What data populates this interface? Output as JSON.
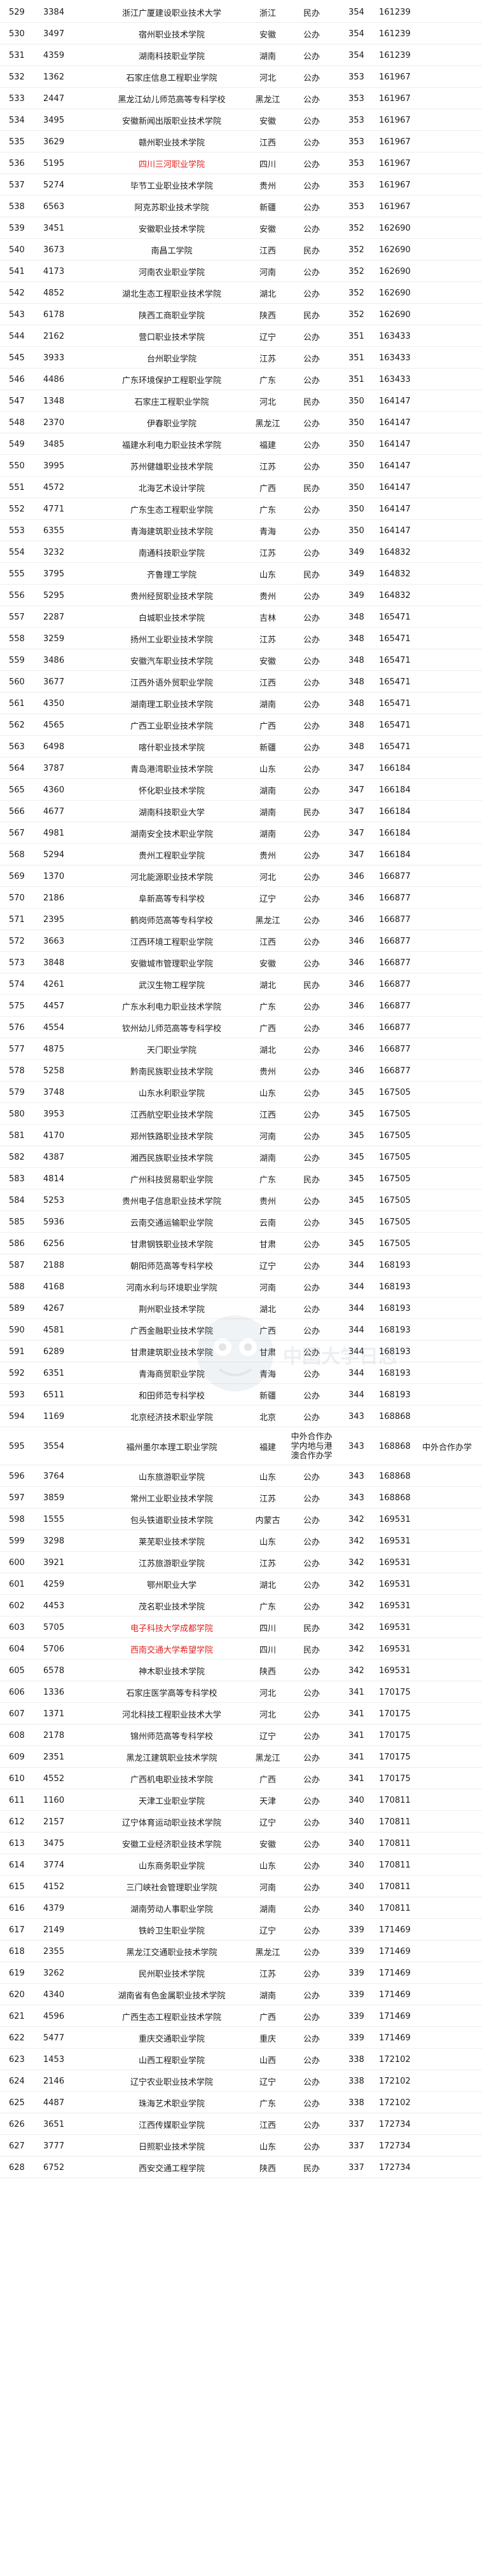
{
  "highlight_color": "#e0221f",
  "watermark": {
    "icon": "cartoon-mascot-face-icon",
    "text": "中国大学日志"
  },
  "rows": [
    {
      "rank": "529",
      "code": "3384",
      "name": "浙江广厦建设职业技术大学",
      "prov": "浙江",
      "type": "民办",
      "score": "354",
      "pos": "161239",
      "note": ""
    },
    {
      "rank": "530",
      "code": "3497",
      "name": "宿州职业技术学院",
      "prov": "安徽",
      "type": "公办",
      "score": "354",
      "pos": "161239",
      "note": ""
    },
    {
      "rank": "531",
      "code": "4359",
      "name": "湖南科技职业学院",
      "prov": "湖南",
      "type": "公办",
      "score": "354",
      "pos": "161239",
      "note": ""
    },
    {
      "rank": "532",
      "code": "1362",
      "name": "石家庄信息工程职业学院",
      "prov": "河北",
      "type": "公办",
      "score": "353",
      "pos": "161967",
      "note": ""
    },
    {
      "rank": "533",
      "code": "2447",
      "name": "黑龙江幼儿师范高等专科学校",
      "prov": "黑龙江",
      "type": "公办",
      "score": "353",
      "pos": "161967",
      "note": ""
    },
    {
      "rank": "534",
      "code": "3495",
      "name": "安徽新闻出版职业技术学院",
      "prov": "安徽",
      "type": "公办",
      "score": "353",
      "pos": "161967",
      "note": ""
    },
    {
      "rank": "535",
      "code": "3629",
      "name": "赣州职业技术学院",
      "prov": "江西",
      "type": "公办",
      "score": "353",
      "pos": "161967",
      "note": ""
    },
    {
      "rank": "536",
      "code": "5195",
      "name": "四川三河职业学院",
      "prov": "四川",
      "type": "公办",
      "score": "353",
      "pos": "161967",
      "note": "",
      "hl": true
    },
    {
      "rank": "537",
      "code": "5274",
      "name": "毕节工业职业技术学院",
      "prov": "贵州",
      "type": "公办",
      "score": "353",
      "pos": "161967",
      "note": ""
    },
    {
      "rank": "538",
      "code": "6563",
      "name": "阿克苏职业技术学院",
      "prov": "新疆",
      "type": "公办",
      "score": "353",
      "pos": "161967",
      "note": ""
    },
    {
      "rank": "539",
      "code": "3451",
      "name": "安徽职业技术学院",
      "prov": "安徽",
      "type": "公办",
      "score": "352",
      "pos": "162690",
      "note": ""
    },
    {
      "rank": "540",
      "code": "3673",
      "name": "南昌工学院",
      "prov": "江西",
      "type": "民办",
      "score": "352",
      "pos": "162690",
      "note": ""
    },
    {
      "rank": "541",
      "code": "4173",
      "name": "河南农业职业学院",
      "prov": "河南",
      "type": "公办",
      "score": "352",
      "pos": "162690",
      "note": ""
    },
    {
      "rank": "542",
      "code": "4852",
      "name": "湖北生态工程职业技术学院",
      "prov": "湖北",
      "type": "公办",
      "score": "352",
      "pos": "162690",
      "note": ""
    },
    {
      "rank": "543",
      "code": "6178",
      "name": "陕西工商职业学院",
      "prov": "陕西",
      "type": "民办",
      "score": "352",
      "pos": "162690",
      "note": ""
    },
    {
      "rank": "544",
      "code": "2162",
      "name": "营口职业技术学院",
      "prov": "辽宁",
      "type": "公办",
      "score": "351",
      "pos": "163433",
      "note": ""
    },
    {
      "rank": "545",
      "code": "3933",
      "name": "台州职业学院",
      "prov": "江苏",
      "type": "公办",
      "score": "351",
      "pos": "163433",
      "note": ""
    },
    {
      "rank": "546",
      "code": "4486",
      "name": "广东环境保护工程职业学院",
      "prov": "广东",
      "type": "公办",
      "score": "351",
      "pos": "163433",
      "note": ""
    },
    {
      "rank": "547",
      "code": "1348",
      "name": "石家庄工程职业学院",
      "prov": "河北",
      "type": "民办",
      "score": "350",
      "pos": "164147",
      "note": ""
    },
    {
      "rank": "548",
      "code": "2370",
      "name": "伊春职业学院",
      "prov": "黑龙江",
      "type": "公办",
      "score": "350",
      "pos": "164147",
      "note": ""
    },
    {
      "rank": "549",
      "code": "3485",
      "name": "福建水利电力职业技术学院",
      "prov": "福建",
      "type": "公办",
      "score": "350",
      "pos": "164147",
      "note": ""
    },
    {
      "rank": "550",
      "code": "3995",
      "name": "苏州健雄职业技术学院",
      "prov": "江苏",
      "type": "公办",
      "score": "350",
      "pos": "164147",
      "note": ""
    },
    {
      "rank": "551",
      "code": "4572",
      "name": "北海艺术设计学院",
      "prov": "广西",
      "type": "民办",
      "score": "350",
      "pos": "164147",
      "note": ""
    },
    {
      "rank": "552",
      "code": "4771",
      "name": "广东生态工程职业学院",
      "prov": "广东",
      "type": "公办",
      "score": "350",
      "pos": "164147",
      "note": ""
    },
    {
      "rank": "553",
      "code": "6355",
      "name": "青海建筑职业技术学院",
      "prov": "青海",
      "type": "公办",
      "score": "350",
      "pos": "164147",
      "note": ""
    },
    {
      "rank": "554",
      "code": "3232",
      "name": "南通科技职业学院",
      "prov": "江苏",
      "type": "公办",
      "score": "349",
      "pos": "164832",
      "note": ""
    },
    {
      "rank": "555",
      "code": "3795",
      "name": "齐鲁理工学院",
      "prov": "山东",
      "type": "民办",
      "score": "349",
      "pos": "164832",
      "note": ""
    },
    {
      "rank": "556",
      "code": "5295",
      "name": "贵州经贸职业技术学院",
      "prov": "贵州",
      "type": "公办",
      "score": "349",
      "pos": "164832",
      "note": ""
    },
    {
      "rank": "557",
      "code": "2287",
      "name": "白城职业技术学院",
      "prov": "吉林",
      "type": "公办",
      "score": "348",
      "pos": "165471",
      "note": ""
    },
    {
      "rank": "558",
      "code": "3259",
      "name": "扬州工业职业技术学院",
      "prov": "江苏",
      "type": "公办",
      "score": "348",
      "pos": "165471",
      "note": ""
    },
    {
      "rank": "559",
      "code": "3486",
      "name": "安徽汽车职业技术学院",
      "prov": "安徽",
      "type": "公办",
      "score": "348",
      "pos": "165471",
      "note": ""
    },
    {
      "rank": "560",
      "code": "3677",
      "name": "江西外语外贸职业学院",
      "prov": "江西",
      "type": "公办",
      "score": "348",
      "pos": "165471",
      "note": ""
    },
    {
      "rank": "561",
      "code": "4350",
      "name": "湖南理工职业技术学院",
      "prov": "湖南",
      "type": "公办",
      "score": "348",
      "pos": "165471",
      "note": ""
    },
    {
      "rank": "562",
      "code": "4565",
      "name": "广西工业职业技术学院",
      "prov": "广西",
      "type": "公办",
      "score": "348",
      "pos": "165471",
      "note": ""
    },
    {
      "rank": "563",
      "code": "6498",
      "name": "喀什职业技术学院",
      "prov": "新疆",
      "type": "公办",
      "score": "348",
      "pos": "165471",
      "note": ""
    },
    {
      "rank": "564",
      "code": "3787",
      "name": "青岛港湾职业技术学院",
      "prov": "山东",
      "type": "公办",
      "score": "347",
      "pos": "166184",
      "note": ""
    },
    {
      "rank": "565",
      "code": "4360",
      "name": "怀化职业技术学院",
      "prov": "湖南",
      "type": "公办",
      "score": "347",
      "pos": "166184",
      "note": ""
    },
    {
      "rank": "566",
      "code": "4677",
      "name": "湖南科技职业大学",
      "prov": "湖南",
      "type": "民办",
      "score": "347",
      "pos": "166184",
      "note": ""
    },
    {
      "rank": "567",
      "code": "4981",
      "name": "湖南安全技术职业学院",
      "prov": "湖南",
      "type": "公办",
      "score": "347",
      "pos": "166184",
      "note": ""
    },
    {
      "rank": "568",
      "code": "5294",
      "name": "贵州工程职业学院",
      "prov": "贵州",
      "type": "公办",
      "score": "347",
      "pos": "166184",
      "note": ""
    },
    {
      "rank": "569",
      "code": "1370",
      "name": "河北能源职业技术学院",
      "prov": "河北",
      "type": "公办",
      "score": "346",
      "pos": "166877",
      "note": ""
    },
    {
      "rank": "570",
      "code": "2186",
      "name": "阜新高等专科学校",
      "prov": "辽宁",
      "type": "公办",
      "score": "346",
      "pos": "166877",
      "note": ""
    },
    {
      "rank": "571",
      "code": "2395",
      "name": "鹤岗师范高等专科学校",
      "prov": "黑龙江",
      "type": "公办",
      "score": "346",
      "pos": "166877",
      "note": ""
    },
    {
      "rank": "572",
      "code": "3663",
      "name": "江西环境工程职业学院",
      "prov": "江西",
      "type": "公办",
      "score": "346",
      "pos": "166877",
      "note": ""
    },
    {
      "rank": "573",
      "code": "3848",
      "name": "安徽城市管理职业学院",
      "prov": "安徽",
      "type": "公办",
      "score": "346",
      "pos": "166877",
      "note": ""
    },
    {
      "rank": "574",
      "code": "4261",
      "name": "武汉生物工程学院",
      "prov": "湖北",
      "type": "民办",
      "score": "346",
      "pos": "166877",
      "note": ""
    },
    {
      "rank": "575",
      "code": "4457",
      "name": "广东水利电力职业技术学院",
      "prov": "广东",
      "type": "公办",
      "score": "346",
      "pos": "166877",
      "note": ""
    },
    {
      "rank": "576",
      "code": "4554",
      "name": "钦州幼儿师范高等专科学校",
      "prov": "广西",
      "type": "公办",
      "score": "346",
      "pos": "166877",
      "note": ""
    },
    {
      "rank": "577",
      "code": "4875",
      "name": "天门职业学院",
      "prov": "湖北",
      "type": "公办",
      "score": "346",
      "pos": "166877",
      "note": ""
    },
    {
      "rank": "578",
      "code": "5258",
      "name": "黔南民族职业技术学院",
      "prov": "贵州",
      "type": "公办",
      "score": "346",
      "pos": "166877",
      "note": ""
    },
    {
      "rank": "579",
      "code": "3748",
      "name": "山东水利职业学院",
      "prov": "山东",
      "type": "公办",
      "score": "345",
      "pos": "167505",
      "note": ""
    },
    {
      "rank": "580",
      "code": "3953",
      "name": "江西航空职业技术学院",
      "prov": "江西",
      "type": "公办",
      "score": "345",
      "pos": "167505",
      "note": ""
    },
    {
      "rank": "581",
      "code": "4170",
      "name": "郑州铁路职业技术学院",
      "prov": "河南",
      "type": "公办",
      "score": "345",
      "pos": "167505",
      "note": ""
    },
    {
      "rank": "582",
      "code": "4387",
      "name": "湘西民族职业技术学院",
      "prov": "湖南",
      "type": "公办",
      "score": "345",
      "pos": "167505",
      "note": ""
    },
    {
      "rank": "583",
      "code": "4814",
      "name": "广州科技贸易职业学院",
      "prov": "广东",
      "type": "民办",
      "score": "345",
      "pos": "167505",
      "note": ""
    },
    {
      "rank": "584",
      "code": "5253",
      "name": "贵州电子信息职业技术学院",
      "prov": "贵州",
      "type": "公办",
      "score": "345",
      "pos": "167505",
      "note": ""
    },
    {
      "rank": "585",
      "code": "5936",
      "name": "云南交通运输职业学院",
      "prov": "云南",
      "type": "公办",
      "score": "345",
      "pos": "167505",
      "note": ""
    },
    {
      "rank": "586",
      "code": "6256",
      "name": "甘肃钢铁职业技术学院",
      "prov": "甘肃",
      "type": "公办",
      "score": "345",
      "pos": "167505",
      "note": ""
    },
    {
      "rank": "587",
      "code": "2188",
      "name": "朝阳师范高等专科学校",
      "prov": "辽宁",
      "type": "公办",
      "score": "344",
      "pos": "168193",
      "note": ""
    },
    {
      "rank": "588",
      "code": "4168",
      "name": "河南水利与环境职业学院",
      "prov": "河南",
      "type": "公办",
      "score": "344",
      "pos": "168193",
      "note": ""
    },
    {
      "rank": "589",
      "code": "4267",
      "name": "荆州职业技术学院",
      "prov": "湖北",
      "type": "公办",
      "score": "344",
      "pos": "168193",
      "note": ""
    },
    {
      "rank": "590",
      "code": "4581",
      "name": "广西金融职业技术学院",
      "prov": "广西",
      "type": "公办",
      "score": "344",
      "pos": "168193",
      "note": ""
    },
    {
      "rank": "591",
      "code": "6289",
      "name": "甘肃建筑职业技术学院",
      "prov": "甘肃",
      "type": "公办",
      "score": "344",
      "pos": "168193",
      "note": ""
    },
    {
      "rank": "592",
      "code": "6351",
      "name": "青海商贸职业学院",
      "prov": "青海",
      "type": "公办",
      "score": "344",
      "pos": "168193",
      "note": ""
    },
    {
      "rank": "593",
      "code": "6511",
      "name": "和田师范专科学校",
      "prov": "新疆",
      "type": "公办",
      "score": "344",
      "pos": "168193",
      "note": ""
    },
    {
      "rank": "594",
      "code": "1169",
      "name": "北京经济技术职业学院",
      "prov": "北京",
      "type": "公办",
      "score": "343",
      "pos": "168868",
      "note": ""
    },
    {
      "rank": "595",
      "code": "3554",
      "name": "福州墨尔本理工职业学院",
      "prov": "福建",
      "type": "中外合作办学内地与港澳合作办学",
      "score": "343",
      "pos": "168868",
      "note": "中外合作办学",
      "tall": true
    },
    {
      "rank": "596",
      "code": "3764",
      "name": "山东旅游职业学院",
      "prov": "山东",
      "type": "公办",
      "score": "343",
      "pos": "168868",
      "note": ""
    },
    {
      "rank": "597",
      "code": "3859",
      "name": "常州工业职业技术学院",
      "prov": "江苏",
      "type": "公办",
      "score": "343",
      "pos": "168868",
      "note": ""
    },
    {
      "rank": "598",
      "code": "1555",
      "name": "包头铁道职业技术学院",
      "prov": "内蒙古",
      "type": "公办",
      "score": "342",
      "pos": "169531",
      "note": ""
    },
    {
      "rank": "599",
      "code": "3298",
      "name": "莱芜职业技术学院",
      "prov": "山东",
      "type": "公办",
      "score": "342",
      "pos": "169531",
      "note": ""
    },
    {
      "rank": "600",
      "code": "3921",
      "name": "江苏旅游职业学院",
      "prov": "江苏",
      "type": "公办",
      "score": "342",
      "pos": "169531",
      "note": ""
    },
    {
      "rank": "601",
      "code": "4259",
      "name": "鄂州职业大学",
      "prov": "湖北",
      "type": "公办",
      "score": "342",
      "pos": "169531",
      "note": ""
    },
    {
      "rank": "602",
      "code": "4453",
      "name": "茂名职业技术学院",
      "prov": "广东",
      "type": "公办",
      "score": "342",
      "pos": "169531",
      "note": ""
    },
    {
      "rank": "603",
      "code": "5705",
      "name": "电子科技大学成都学院",
      "prov": "四川",
      "type": "民办",
      "score": "342",
      "pos": "169531",
      "note": "",
      "hl": true
    },
    {
      "rank": "604",
      "code": "5706",
      "name": "西南交通大学希望学院",
      "prov": "四川",
      "type": "民办",
      "score": "342",
      "pos": "169531",
      "note": "",
      "hl": true
    },
    {
      "rank": "605",
      "code": "6578",
      "name": "神木职业技术学院",
      "prov": "陕西",
      "type": "公办",
      "score": "342",
      "pos": "169531",
      "note": ""
    },
    {
      "rank": "606",
      "code": "1336",
      "name": "石家庄医学高等专科学校",
      "prov": "河北",
      "type": "公办",
      "score": "341",
      "pos": "170175",
      "note": ""
    },
    {
      "rank": "607",
      "code": "1371",
      "name": "河北科技工程职业技术大学",
      "prov": "河北",
      "type": "公办",
      "score": "341",
      "pos": "170175",
      "note": ""
    },
    {
      "rank": "608",
      "code": "2178",
      "name": "锦州师范高等专科学校",
      "prov": "辽宁",
      "type": "公办",
      "score": "341",
      "pos": "170175",
      "note": ""
    },
    {
      "rank": "609",
      "code": "2351",
      "name": "黑龙江建筑职业技术学院",
      "prov": "黑龙江",
      "type": "公办",
      "score": "341",
      "pos": "170175",
      "note": ""
    },
    {
      "rank": "610",
      "code": "4552",
      "name": "广西机电职业技术学院",
      "prov": "广西",
      "type": "公办",
      "score": "341",
      "pos": "170175",
      "note": ""
    },
    {
      "rank": "611",
      "code": "1160",
      "name": "天津工业职业学院",
      "prov": "天津",
      "type": "公办",
      "score": "340",
      "pos": "170811",
      "note": ""
    },
    {
      "rank": "612",
      "code": "2157",
      "name": "辽宁体育运动职业技术学院",
      "prov": "辽宁",
      "type": "公办",
      "score": "340",
      "pos": "170811",
      "note": ""
    },
    {
      "rank": "613",
      "code": "3475",
      "name": "安徽工业经济职业技术学院",
      "prov": "安徽",
      "type": "公办",
      "score": "340",
      "pos": "170811",
      "note": ""
    },
    {
      "rank": "614",
      "code": "3774",
      "name": "山东商务职业学院",
      "prov": "山东",
      "type": "公办",
      "score": "340",
      "pos": "170811",
      "note": ""
    },
    {
      "rank": "615",
      "code": "4152",
      "name": "三门峡社会管理职业学院",
      "prov": "河南",
      "type": "公办",
      "score": "340",
      "pos": "170811",
      "note": ""
    },
    {
      "rank": "616",
      "code": "4379",
      "name": "湖南劳动人事职业学院",
      "prov": "湖南",
      "type": "公办",
      "score": "340",
      "pos": "170811",
      "note": ""
    },
    {
      "rank": "617",
      "code": "2149",
      "name": "铁岭卫生职业学院",
      "prov": "辽宁",
      "type": "公办",
      "score": "339",
      "pos": "171469",
      "note": ""
    },
    {
      "rank": "618",
      "code": "2355",
      "name": "黑龙江交通职业技术学院",
      "prov": "黑龙江",
      "type": "公办",
      "score": "339",
      "pos": "171469",
      "note": ""
    },
    {
      "rank": "619",
      "code": "3262",
      "name": "民州职业技术学院",
      "prov": "江苏",
      "type": "公办",
      "score": "339",
      "pos": "171469",
      "note": ""
    },
    {
      "rank": "620",
      "code": "4340",
      "name": "湖南省有色金属职业技术学院",
      "prov": "湖南",
      "type": "公办",
      "score": "339",
      "pos": "171469",
      "note": ""
    },
    {
      "rank": "621",
      "code": "4596",
      "name": "广西生态工程职业技术学院",
      "prov": "广西",
      "type": "公办",
      "score": "339",
      "pos": "171469",
      "note": ""
    },
    {
      "rank": "622",
      "code": "5477",
      "name": "重庆交通职业学院",
      "prov": "重庆",
      "type": "公办",
      "score": "339",
      "pos": "171469",
      "note": ""
    },
    {
      "rank": "623",
      "code": "1453",
      "name": "山西工程职业学院",
      "prov": "山西",
      "type": "公办",
      "score": "338",
      "pos": "172102",
      "note": ""
    },
    {
      "rank": "624",
      "code": "2146",
      "name": "辽宁农业职业技术学院",
      "prov": "辽宁",
      "type": "公办",
      "score": "338",
      "pos": "172102",
      "note": ""
    },
    {
      "rank": "625",
      "code": "4487",
      "name": "珠海艺术职业学院",
      "prov": "广东",
      "type": "公办",
      "score": "338",
      "pos": "172102",
      "note": ""
    },
    {
      "rank": "626",
      "code": "3651",
      "name": "江西传媒职业学院",
      "prov": "江西",
      "type": "公办",
      "score": "337",
      "pos": "172734",
      "note": ""
    },
    {
      "rank": "627",
      "code": "3777",
      "name": "日照职业技术学院",
      "prov": "山东",
      "type": "公办",
      "score": "337",
      "pos": "172734",
      "note": ""
    },
    {
      "rank": "628",
      "code": "6752",
      "name": "西安交通工程学院",
      "prov": "陕西",
      "type": "民办",
      "score": "337",
      "pos": "172734",
      "note": ""
    }
  ]
}
